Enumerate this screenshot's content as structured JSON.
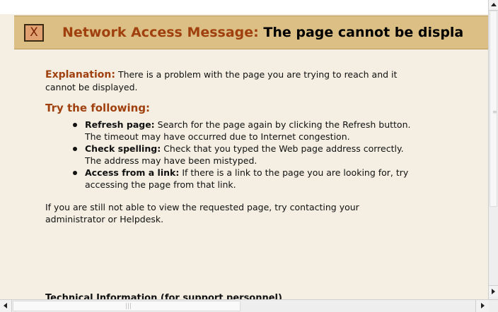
{
  "header": {
    "close_glyph": "X",
    "label": "Network Access Message:",
    "text": "The page cannot be displa"
  },
  "explanation": {
    "label": "Explanation:",
    "text": "There is a problem with the page you are trying to reach and it cannot be displayed."
  },
  "try_title": "Try the following:",
  "tips": [
    {
      "label": "Refresh page:",
      "text": "Search for the page again by clicking the Refresh button. The timeout may have occurred due to Internet congestion."
    },
    {
      "label": "Check spelling:",
      "text": "Check that you typed the Web page address correctly. The address may have been mistyped."
    },
    {
      "label": "Access from a link:",
      "text": "If there is a link to the page you are looking for, try accessing the page from that link."
    }
  ],
  "closing": "If you are still not able to view the requested page, try contacting your administrator or Helpdesk.",
  "tech_info_partial": "Technical Information (for support personnel)",
  "colors": {
    "header_bg": "#dbbf84",
    "label_brown": "#a0400f",
    "page_bg": "#f4efe2"
  }
}
